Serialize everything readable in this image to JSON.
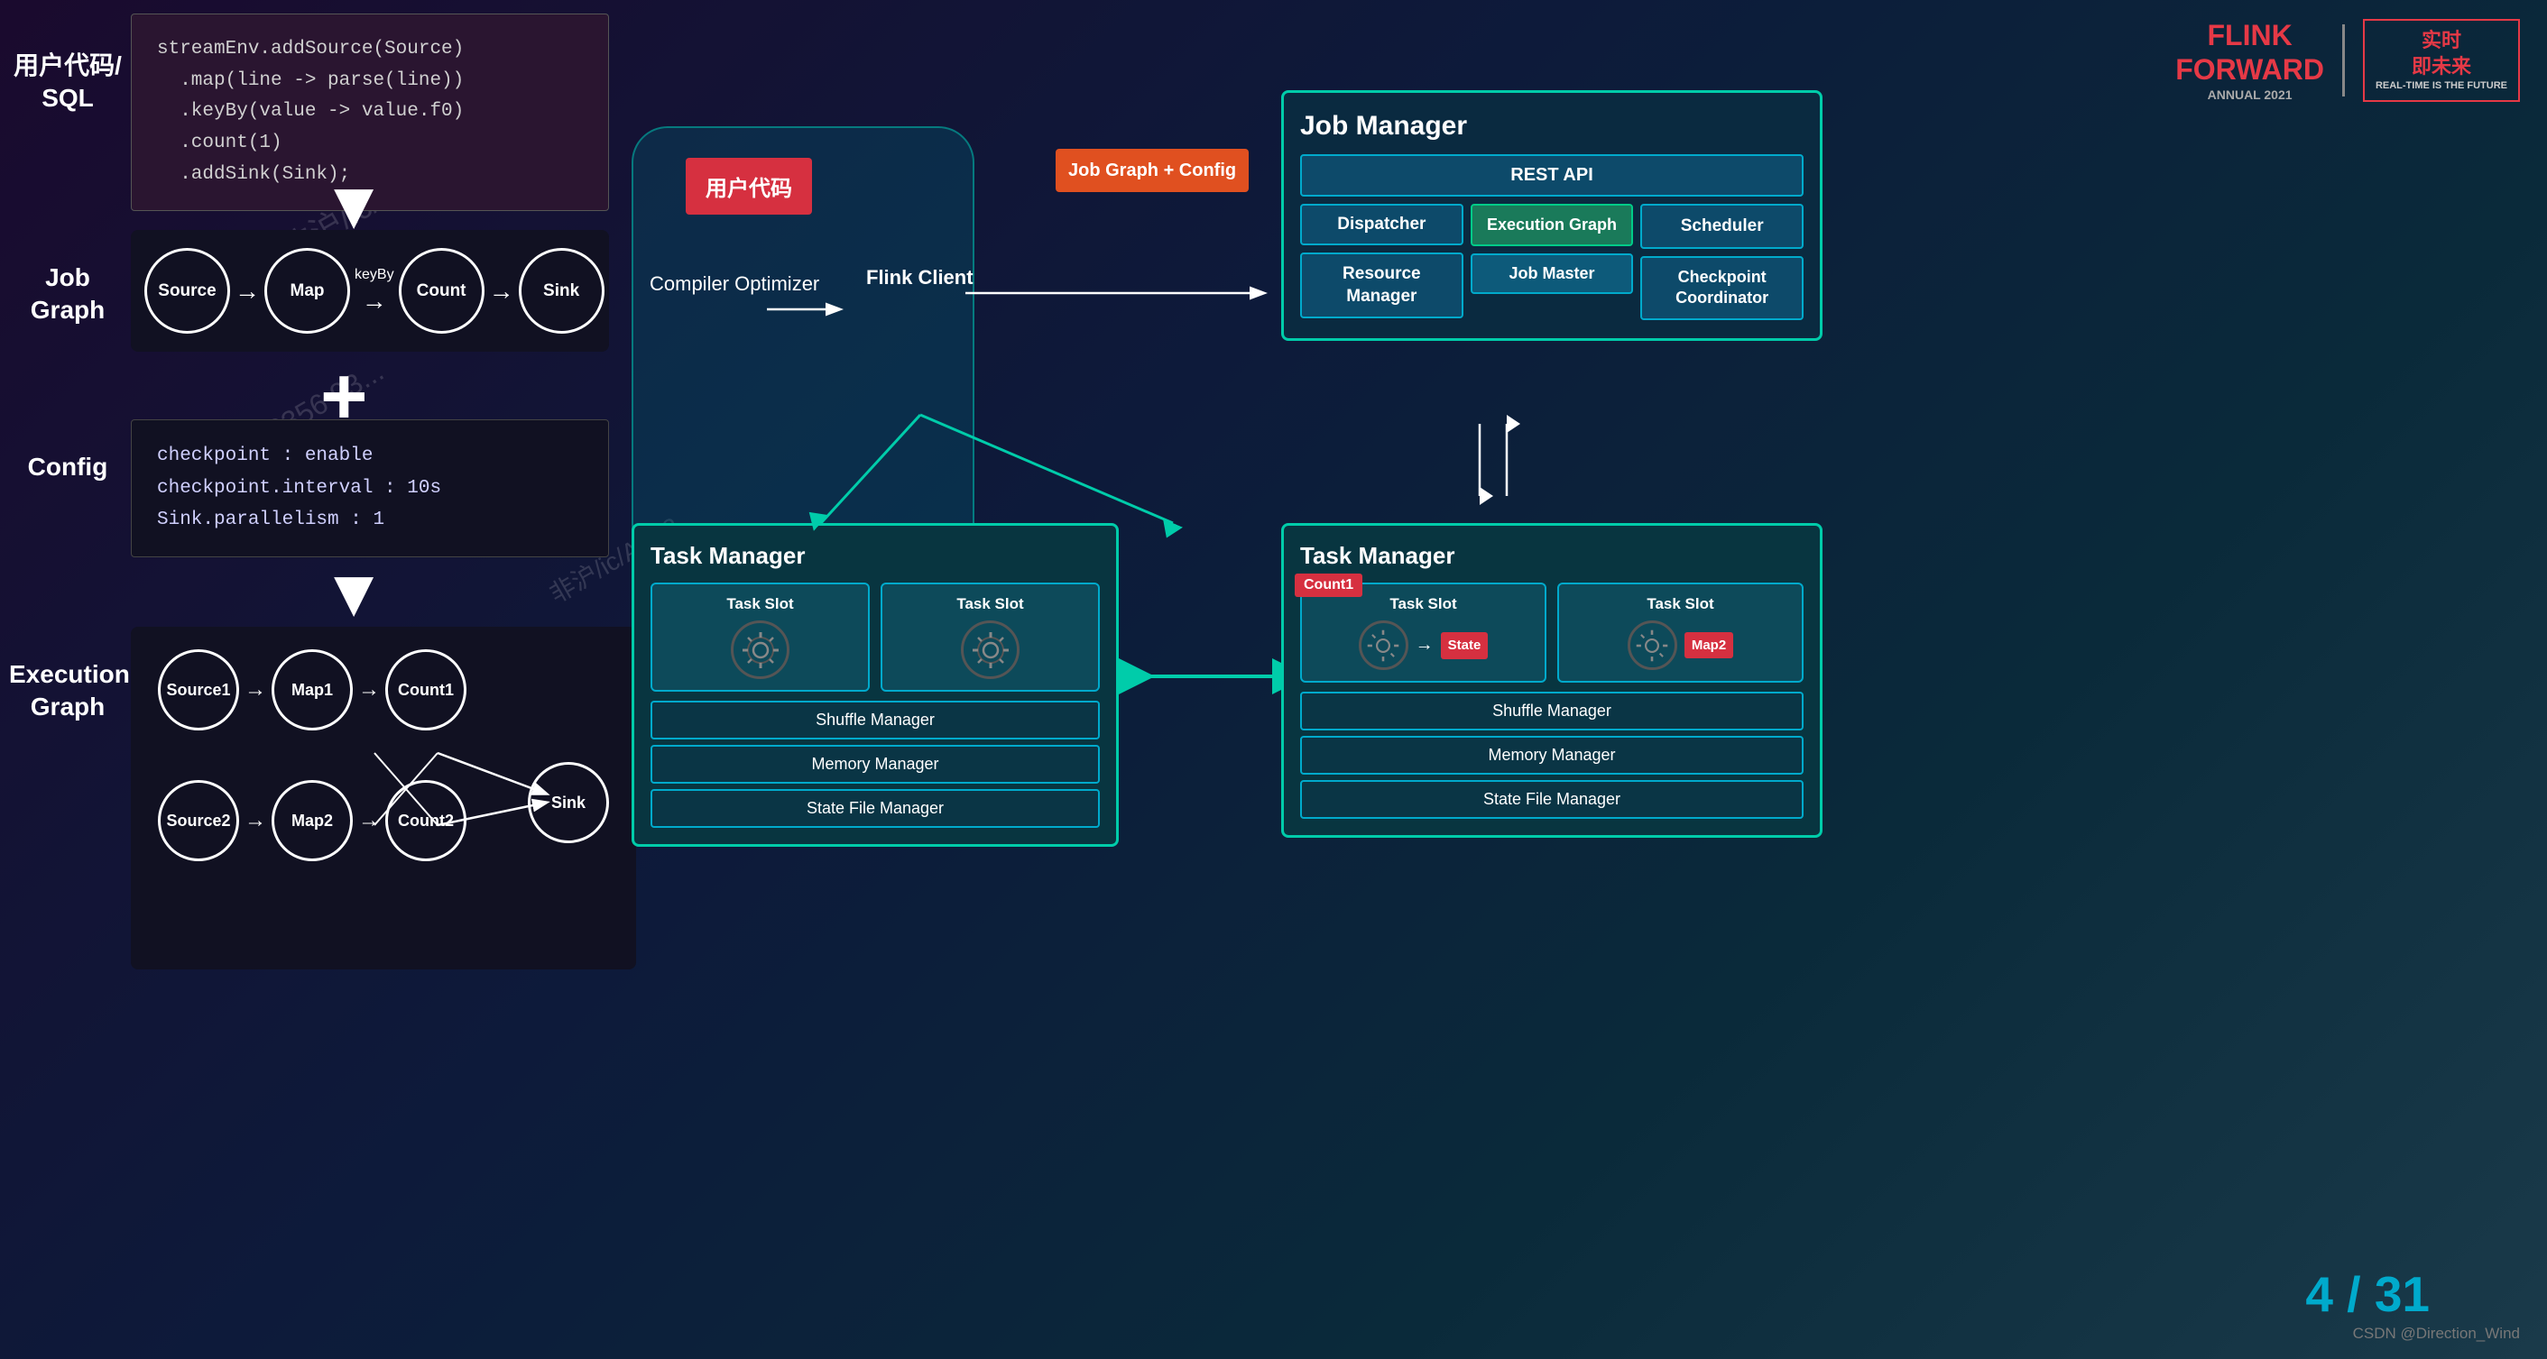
{
  "header": {
    "flink_forward": "FLINK\nFORWARD",
    "flink_forward_sub": "ANNUAL 2021",
    "realtime_title": "实时\n即未来",
    "realtime_sub": "REAL-TIME IS THE FUTURE"
  },
  "left": {
    "user_code_label": "用户代码/\nSQL",
    "code_lines": [
      "streamEnv.addSource(Source)",
      "  .map(line -> parse(line))",
      "  .keyBy(value -> value.f0)",
      "  .count(1)",
      "  .addSink(Sink);"
    ],
    "job_graph_label": "Job\nGraph",
    "nodes_job_graph": [
      "Source",
      "Map",
      "Count",
      "Sink"
    ],
    "keyby_label": "keyBy",
    "config_label": "Config",
    "config_lines": [
      "checkpoint : enable",
      "checkpoint.interval : 10s",
      "Sink.parallelism : 1"
    ],
    "exec_graph_label": "Execution\nGraph",
    "exec_nodes_row1": [
      "Source1",
      "Map1",
      "Count1"
    ],
    "exec_nodes_row2": [
      "Source2",
      "Map2",
      "Count2"
    ],
    "exec_sink": "Sink"
  },
  "center": {
    "user_code_box": "用户代码",
    "compiler_optimizer": "Compiler\nOptimizer",
    "flink_client": "Flink Client",
    "job_graph_config": "Job Graph\n+ Config"
  },
  "job_manager": {
    "title": "Job Manager",
    "rest_api": "REST API",
    "dispatcher": "Dispatcher",
    "resource_manager": "Resource\nManager",
    "execution_graph": "Execution\nGraph",
    "job_master": "Job\nMaster",
    "scheduler": "Scheduler",
    "checkpoint_coordinator": "Checkpoint\nCoordinator"
  },
  "task_manager_left": {
    "title": "Task Manager",
    "slot1": "Task Slot",
    "slot2": "Task Slot",
    "shuffle_manager": "Shuffle Manager",
    "memory_manager": "Memory Manager",
    "state_file_manager": "State File Manager"
  },
  "task_manager_right": {
    "title": "Task Manager",
    "slot1": "Task Slot",
    "slot2": "Task Slot",
    "count1_badge": "Count1",
    "state_badge": "State",
    "map2_badge": "Map2",
    "shuffle_manager": "Shuffle Manager",
    "memory_manager": "Memory Manager",
    "state_file_manager": "State File Manager"
  },
  "page": {
    "current": "4",
    "total": "31",
    "separator": "/",
    "csdn": "CSDN @Direction_Wind"
  }
}
